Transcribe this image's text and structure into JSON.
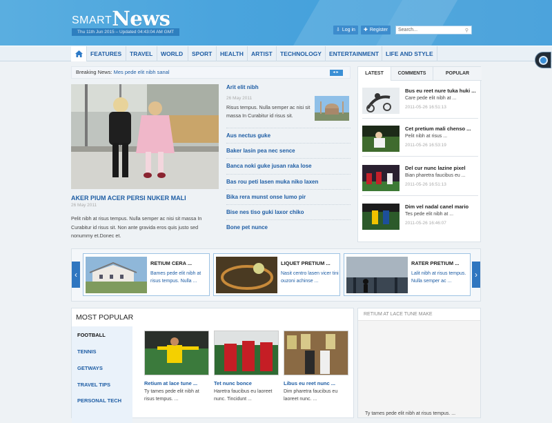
{
  "header": {
    "logo_smart": "SMART",
    "logo_news": "News",
    "date_line": "Thu 11th Jun 2015 – Updated 04:43:04 AM GMT",
    "login": "Log in",
    "register": "Register",
    "search_placeholder": "Search..."
  },
  "nav": {
    "items": [
      "FEATURES",
      "TRAVEL",
      "WORLD",
      "SPORT",
      "HEALTH",
      "ARTIST",
      "TECHNOLOGY",
      "ENTERTAINMENT",
      "LIFE AND STYLE"
    ]
  },
  "breaking": {
    "label": "Breaking News:",
    "text": "Mes pede elit nibh sanal"
  },
  "feature": {
    "title": "AKER PIUM ACER PERSI NUKER MALI",
    "date": "26 May 2011",
    "desc": "Pelit nibh at risus tempus. Nulla semper ac nisi sit massa In Curabitur id risus sit. Non ante gravida eros quis justo sed nonummy et.Donec et."
  },
  "articles": {
    "first": {
      "title": "Arit elit nibh",
      "date": "26 May 2011",
      "desc": "Risus tempus. Nulla semper ac nisi sit massa In Curabitur id risus sit."
    },
    "list": [
      "Aus nectus guke",
      "Baker lasin pea nec sence",
      "Banca noki guke jusan raka lose",
      "Bas rou peti lasen muka niko laxen",
      "Bika rera munst onse lumo pir",
      "Bise nes tiso guki laxor chiko",
      "Bone pet nunce"
    ]
  },
  "tabs": {
    "labels": [
      "LATEST",
      "COMMENTS",
      "POPULAR"
    ],
    "items": [
      {
        "title": "Bus eu reet nure tuka huki ...",
        "desc": "Care pede elit nibh at ...",
        "date": "2011-05-26 16:51:13"
      },
      {
        "title": "Cet pretium mali chenso ...",
        "desc": "Pelit nibh at risus ...",
        "date": "2011-05-26 16:53:19"
      },
      {
        "title": "Del cur nunc lazine pixel",
        "desc": "Bian pharetra faucibus eu ...",
        "date": "2011-05-26 16:51:13"
      },
      {
        "title": "Dim vel nadal canel mario",
        "desc": "Tes pede elit nibh at ...",
        "date": "2011-05-26 16:46:07"
      }
    ]
  },
  "carousel": {
    "cards": [
      {
        "title": "RETIUM CERA ...",
        "desc": "Bames pede elit nibh at risus tempus. Nulla ..."
      },
      {
        "title": "LIQUET PRETIUM ...",
        "desc": "Nasit centro lasen vicer tini ouzoni achinse ..."
      },
      {
        "title": "RATER PRETIUM ...",
        "desc": "Lalit nibh at risus tempus. Nulla semper ac ..."
      }
    ]
  },
  "popular": {
    "heading": "MOST POPULAR",
    "categories": [
      "FOOTBALL",
      "TENNIS",
      "GETWAYS",
      "TRAVEL TIPS",
      "PERSONAL TECH"
    ],
    "items": [
      {
        "title": "Retium at lace tune ...",
        "desc": "Ty tames pede elit nibh at risus tempus. ..."
      },
      {
        "title": "Tet nunc bonce",
        "desc": "Haretra faucibus eu laoreet nunc. Tincidunt ..."
      },
      {
        "title": "Libus eu reet nunc ...",
        "desc": "Dim pharetra faucibus eu laoreet nunc. ..."
      }
    ]
  },
  "right_box": {
    "heading": "RETIUM AT LACE TUNE MAKE",
    "footer": "Ty tames pede elit nibh at risus tempus. ..."
  }
}
